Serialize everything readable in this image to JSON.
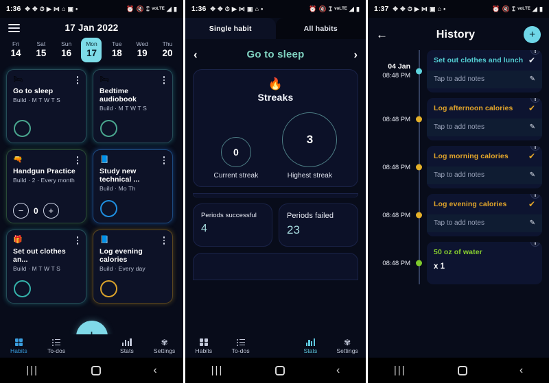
{
  "panel1": {
    "statusbar": {
      "time": "1:36",
      "left_icons": [
        "puzzle-icon",
        "puzzle-icon",
        "alarm-icon",
        "play-icon",
        "shuffle-icon",
        "home-assistant-icon",
        "image-icon",
        "dot-icon"
      ],
      "right_icons": [
        "alarm-icon",
        "mute-icon",
        "cast-icon",
        "volte-icon",
        "signal-icon",
        "battery-icon"
      ]
    },
    "header": {
      "menu": "menu-icon",
      "date_title": "17 Jan 2022"
    },
    "week": [
      {
        "dow": "Fri",
        "num": "14",
        "selected": false
      },
      {
        "dow": "Sat",
        "num": "15",
        "selected": false
      },
      {
        "dow": "Sun",
        "num": "16",
        "selected": false
      },
      {
        "dow": "Mon",
        "num": "17",
        "selected": true
      },
      {
        "dow": "Tue",
        "num": "18",
        "selected": false
      },
      {
        "dow": "Wed",
        "num": "19",
        "selected": false
      },
      {
        "dow": "Thu",
        "num": "20",
        "selected": false
      }
    ],
    "cards": [
      {
        "emoji": "🛏",
        "title": "Go to sleep",
        "sub": "Build · M T W T S",
        "control": "ring"
      },
      {
        "emoji": "🛏",
        "title": "Bedtime audiobook",
        "sub": "Build · M T W T S",
        "control": "ring"
      },
      {
        "emoji": "🔫",
        "title": "Handgun Practice",
        "sub": "Build · 2 · Every month",
        "control": "counter",
        "count": "0",
        "minus": "−",
        "plus": "+"
      },
      {
        "emoji": "📘",
        "title": "Study new technical ...",
        "sub": "Build · Mo Th",
        "control": "ring"
      },
      {
        "emoji": "🎁",
        "title": "Set out clothes an...",
        "sub": "Build · M T W T S",
        "control": "ring"
      },
      {
        "emoji": "📘",
        "title": "Log evening calories",
        "sub": "Build · Every day",
        "control": "ring"
      }
    ],
    "fab": "+",
    "nav": [
      {
        "label": "Habits",
        "icon": "grid-icon",
        "active": true
      },
      {
        "label": "To-dos",
        "icon": "list-icon",
        "active": false
      },
      {
        "label": "Stats",
        "icon": "bar-chart-icon",
        "active": false
      },
      {
        "label": "Settings",
        "icon": "gear-icon",
        "active": false
      }
    ],
    "androidnav": {
      "recent": "|||",
      "home": "home-icon",
      "back": "‹"
    }
  },
  "panel2": {
    "statusbar": {
      "time": "1:36"
    },
    "tabs": [
      {
        "label": "Single habit",
        "selected": true
      },
      {
        "label": "All habits",
        "selected": false
      }
    ],
    "habit_nav": {
      "prev": "‹",
      "name": "Go to sleep",
      "next": "›"
    },
    "streaks": {
      "icon": "flame-icon",
      "title": "Streaks",
      "current_value": "0",
      "current_label": "Current streak",
      "highest_value": "3",
      "highest_label": "Highest streak"
    },
    "periods": [
      {
        "label": "Periods successful",
        "value": "4"
      },
      {
        "label": "Periods failed",
        "value": "23"
      }
    ],
    "nav": [
      {
        "label": "Habits",
        "icon": "grid-icon",
        "active": false
      },
      {
        "label": "To-dos",
        "icon": "list-icon",
        "active": false
      },
      {
        "label": "Stats",
        "icon": "bar-chart-icon",
        "active": true
      },
      {
        "label": "Settings",
        "icon": "gear-icon",
        "active": false
      }
    ],
    "androidnav": {
      "recent": "|||",
      "home": "home-icon",
      "back": "‹"
    }
  },
  "panel3": {
    "statusbar": {
      "time": "1:37"
    },
    "header": {
      "back": "←",
      "title": "History",
      "add": "+"
    },
    "entries": [
      {
        "date": "04 Jan",
        "time": "08:48 PM",
        "dot": "teal",
        "title": "Set out clothes and lunch",
        "color": "teal",
        "check": "✔",
        "notes_placeholder": "Tap to add notes",
        "pencil": "✎",
        "qty": null
      },
      {
        "date": "",
        "time": "08:48 PM",
        "dot": "amber",
        "title": "Log afternoon calories",
        "color": "amber",
        "check": "✔",
        "notes_placeholder": "Tap to add notes",
        "pencil": "✎",
        "qty": null
      },
      {
        "date": "",
        "time": "08:48 PM",
        "dot": "amber",
        "title": "Log morning calories",
        "color": "amber",
        "check": "✔",
        "notes_placeholder": "Tap to add notes",
        "pencil": "✎",
        "qty": null
      },
      {
        "date": "",
        "time": "08:48 PM",
        "dot": "amber",
        "title": "Log evening calories",
        "color": "amber",
        "check": "✔",
        "notes_placeholder": "Tap to add notes",
        "pencil": "✎",
        "qty": null
      },
      {
        "date": "",
        "time": "08:48 PM",
        "dot": "green",
        "title": "50 oz of water",
        "color": "green",
        "check": "",
        "notes_placeholder": "",
        "pencil": "",
        "qty": "x 1"
      }
    ],
    "androidnav": {
      "recent": "|||",
      "home": "home-icon",
      "back": "‹"
    }
  },
  "colors": {
    "accent_cyan": "#7fd9e8",
    "accent_teal": "#54cfd4",
    "accent_amber": "#e3a62a",
    "accent_green": "#88cf2f",
    "accent_blue": "#3a9fe0",
    "bg_dark": "#080c1a",
    "card_bg": "#0d1227"
  }
}
